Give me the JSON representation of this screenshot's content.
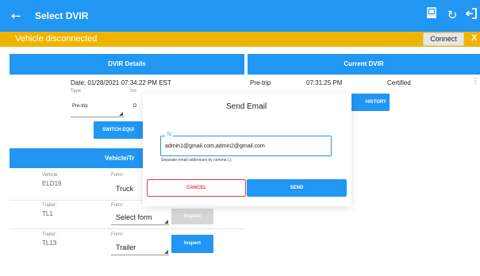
{
  "header": {
    "title": "Select DVIR",
    "back_icon": "arrow-left-icon",
    "icons": [
      "device-icon",
      "refresh-icon",
      "logout-icon"
    ],
    "color": "#2196f3"
  },
  "banner": {
    "message": "Vehicle disconnected",
    "connect_label": "Connect",
    "close_label": "X",
    "color": "#f0b400"
  },
  "dvir_details": {
    "header": "DVIR Details",
    "date": "Date: 01/28/2021 07:34:22 PM EST",
    "type_label": "Type",
    "type_label_2": "Ins",
    "type_value": "Pre-trip",
    "type_value_2": "D",
    "switch_button": "SWITCH EQUI"
  },
  "vehicle_section": {
    "header": "Vehicle/Tr",
    "rows": [
      {
        "unit_label": "Vehicle:",
        "unit": "ELD19",
        "form_label": "Form:",
        "form": "Truck",
        "inspect": ""
      },
      {
        "unit_label": "Trailer:",
        "unit": "TL1",
        "form_label": "Form:",
        "form": "Select form",
        "inspect": "Inspect"
      },
      {
        "unit_label": "Trailer:",
        "unit": "TL13",
        "form_label": "Form:",
        "form": "Trailer",
        "inspect": "Inspect"
      }
    ]
  },
  "current_dvir": {
    "header": "Current DVIR",
    "type": "Pre-trip",
    "time": "07:31:25 PM",
    "status": "Certified",
    "history_button": "HISTORY"
  },
  "dialog": {
    "title": "Send Email",
    "to_label": "To",
    "to_value": "admin1@gmail.com,admin2@gmail.com",
    "hint": "Separate email addresses by comma (,)",
    "cancel": "CANCEL",
    "send": "SEND"
  }
}
